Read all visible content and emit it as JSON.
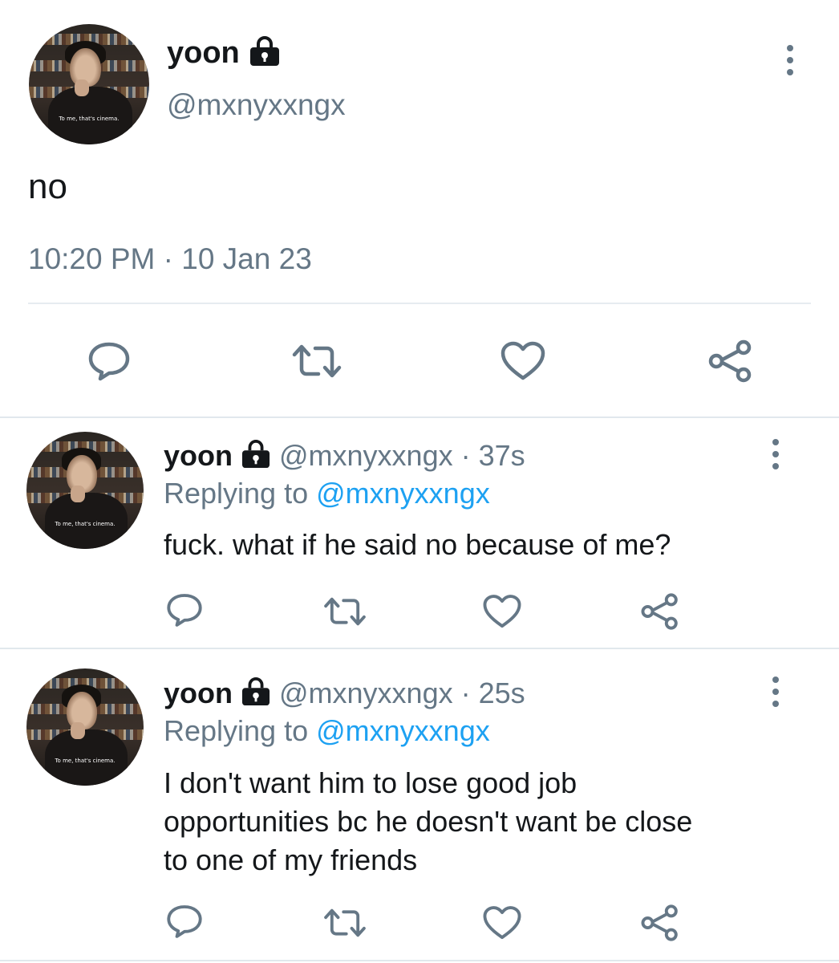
{
  "main_tweet": {
    "display_name": "yoon",
    "handle": "@mxnyxxngx",
    "avatar_caption": "To me, that's cinema.",
    "text": "no",
    "timestamp": "10:20 PM · 10 Jan 23"
  },
  "replies": [
    {
      "display_name": "yoon",
      "handle_time": "@mxnyxxngx · 37s",
      "replying_prefix": "Replying to",
      "replying_to": "@mxnyxxngx",
      "avatar_caption": "To me, that's cinema.",
      "text_lines": [
        "fuck. what if he said no because of me?"
      ]
    },
    {
      "display_name": "yoon",
      "handle_time": "@mxnyxxngx · 25s",
      "replying_prefix": "Replying to",
      "replying_to": "@mxnyxxngx",
      "avatar_caption": "To me, that's cinema.",
      "text_lines": [
        "I don't want him to lose good job",
        "opportunities bc he doesn't want be close",
        "to one of my friends"
      ]
    }
  ],
  "icons": [
    "lock-icon",
    "more-icon",
    "reply-icon",
    "retweet-icon",
    "like-icon",
    "share-icon"
  ],
  "colors": {
    "text": "#14171a",
    "muted": "#657786",
    "link": "#1da1f2",
    "divider": "#e1e8ed"
  }
}
